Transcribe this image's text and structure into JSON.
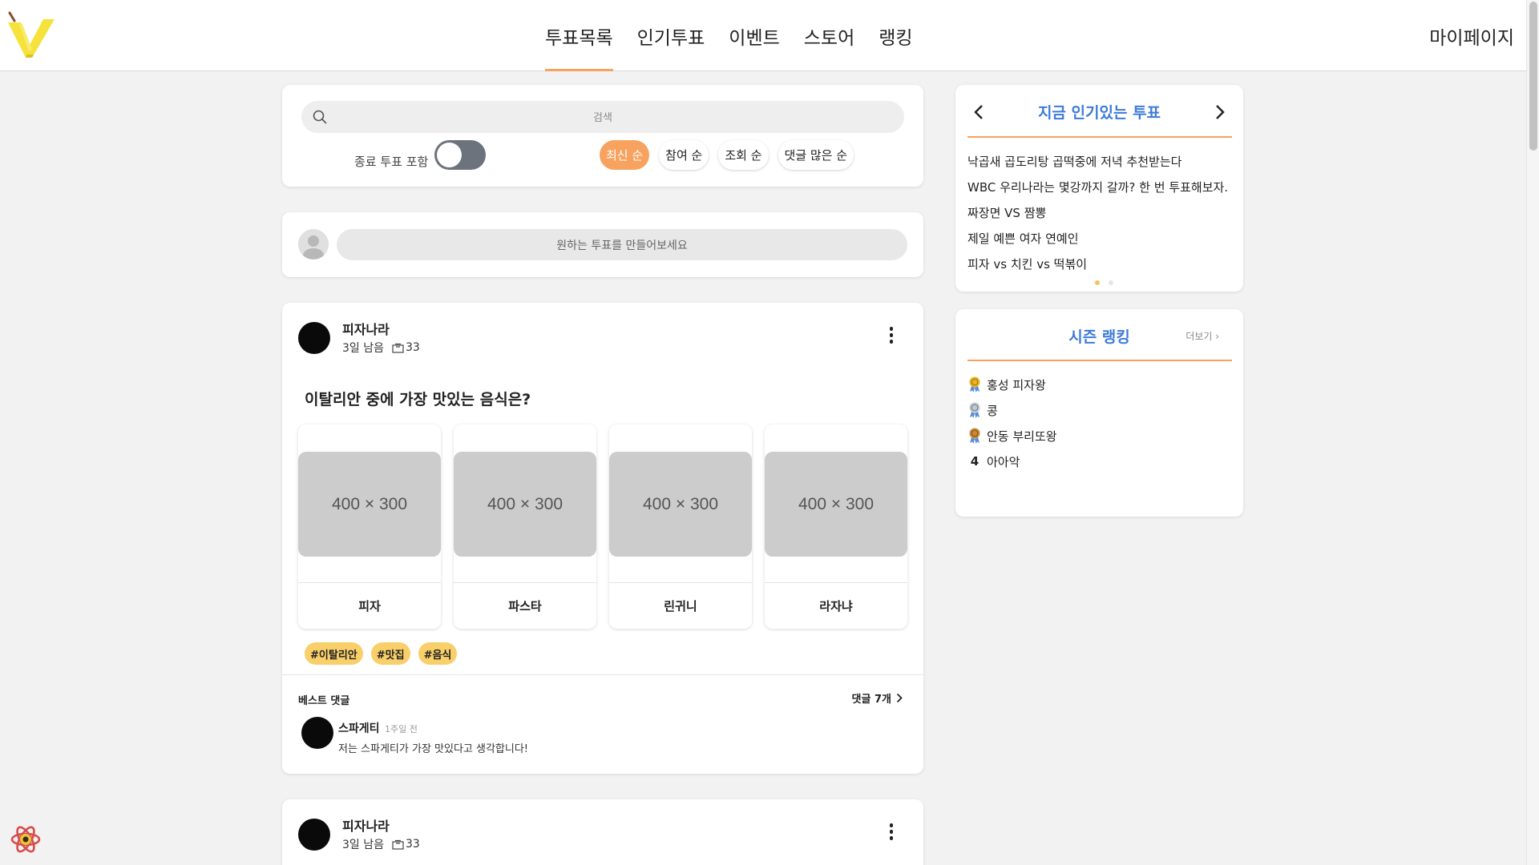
{
  "header": {
    "nav": [
      {
        "label": "투표목록",
        "active": true
      },
      {
        "label": "인기투표",
        "active": false
      },
      {
        "label": "이벤트",
        "active": false
      },
      {
        "label": "스토어",
        "active": false
      },
      {
        "label": "랭킹",
        "active": false
      }
    ],
    "mypage_label": "마이페이지"
  },
  "search": {
    "placeholder": "검색",
    "include_closed_label": "종료 투표 포함",
    "sort_options": [
      {
        "label": "최신 순",
        "active": true
      },
      {
        "label": "참여 순",
        "active": false
      },
      {
        "label": "조회 순",
        "active": false
      },
      {
        "label": "댓글 많은 순",
        "active": false
      }
    ]
  },
  "create": {
    "placeholder": "원하는 투표를 만들어보세요"
  },
  "posts": [
    {
      "author": "피자나라",
      "time_left": "3일 남음",
      "views": "33",
      "title": "이탈리안 중에 가장 맛있는 음식은?",
      "options": [
        {
          "image_text": "400 × 300",
          "label": "피자"
        },
        {
          "image_text": "400 × 300",
          "label": "파스타"
        },
        {
          "image_text": "400 × 300",
          "label": "린귀니"
        },
        {
          "image_text": "400 × 300",
          "label": "라자냐"
        }
      ],
      "tags": [
        "#이탈리안",
        "#맛집",
        "#음식"
      ],
      "best_comment_label": "베스트 댓글",
      "comments_link": "댓글 7개",
      "best_comment": {
        "author": "스파게티",
        "time": "1주일 전",
        "text": "저는 스파게티가 가장 맛있다고 생각합니다!"
      }
    },
    {
      "author": "피자나라",
      "time_left": "3일 남음",
      "views": "33"
    }
  ],
  "popular": {
    "title": "지금 인기있는 투표",
    "items": [
      "낙곱새 곱도리탕 곱떡중에 저녁 추천받는다",
      "WBC 우리나라는 몇강까지 갈까? 한 번 투표해보자.",
      "짜장면 VS 짬뽕",
      "제일 예쁜 여자 연예인",
      "피자 vs 치킨 vs 떡볶이"
    ],
    "page_count": 2,
    "current_page": 1
  },
  "ranking": {
    "title": "시즌 랭킹",
    "more_label": "더보기 ›",
    "items": [
      {
        "rank": 1,
        "medal": "gold",
        "name": "홍성 피자왕"
      },
      {
        "rank": 2,
        "medal": "silver",
        "name": "콩"
      },
      {
        "rank": 3,
        "medal": "bronze",
        "name": "안동 부리또왕"
      },
      {
        "rank": "4",
        "medal": null,
        "name": "아아악"
      }
    ]
  },
  "colors": {
    "accent": "#f7a25e",
    "title_blue": "#3d7bd8",
    "tag_yellow": "#f9cf6a",
    "toggle_off": "#6c737d"
  }
}
